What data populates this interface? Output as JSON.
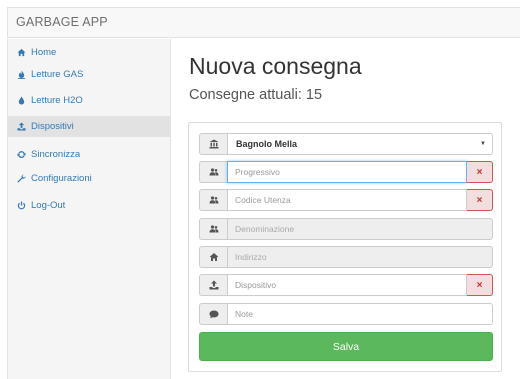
{
  "app": {
    "title": "GARBAGE APP"
  },
  "sidebar": {
    "items": [
      {
        "label": "Home",
        "icon": "home-icon"
      },
      {
        "label": "Letture GAS",
        "icon": "fire-icon"
      },
      {
        "label": "Letture H2O",
        "icon": "drop-icon"
      },
      {
        "label": "Dispositivi",
        "icon": "upload-icon",
        "active": true
      },
      {
        "label": "Sincronizza",
        "icon": "refresh-icon"
      },
      {
        "label": "Configurazioni",
        "icon": "wrench-icon"
      },
      {
        "label": "Log-Out",
        "icon": "power-icon"
      }
    ]
  },
  "main": {
    "title": "Nuova consegna",
    "subtitle": "Consegne attuali: 15",
    "form": {
      "comune": {
        "value": "Bagnolo Mella",
        "icon": "bank-icon"
      },
      "progressivo": {
        "placeholder": "Progressivo",
        "icon": "users-icon"
      },
      "codice_utenza": {
        "placeholder": "Codice Utenza",
        "icon": "users-icon"
      },
      "denominazione": {
        "placeholder": "Denominazione",
        "icon": "users-icon"
      },
      "indirizzo": {
        "placeholder": "Indirizzo",
        "icon": "home-icon"
      },
      "dispositivo": {
        "placeholder": "Dispositivo",
        "icon": "upload-icon"
      },
      "note": {
        "placeholder": "Note",
        "icon": "comment-icon"
      },
      "remove_symbol": "×",
      "save_label": "Salva"
    }
  },
  "colors": {
    "link": "#337ab7",
    "success": "#5cb85c",
    "danger": "#d9534f"
  }
}
